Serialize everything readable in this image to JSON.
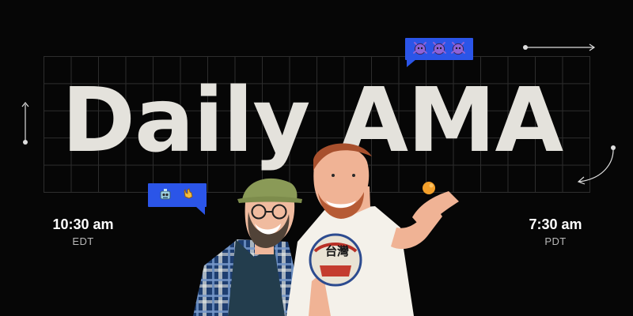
{
  "banner": {
    "title": "Daily AMA",
    "accent_color": "#2b55e8",
    "background_color": "#060606",
    "title_color": "#e4e2dc"
  },
  "times": {
    "eastern": {
      "time": "10:30 am",
      "zone": "EDT"
    },
    "pacific": {
      "time": "7:30 am",
      "zone": "PDT"
    }
  },
  "bubbles": {
    "top_icons": [
      "alien-icon",
      "alien-icon",
      "alien-icon"
    ],
    "left_icons": [
      "robot-icon",
      "rock-hand-icon"
    ]
  }
}
